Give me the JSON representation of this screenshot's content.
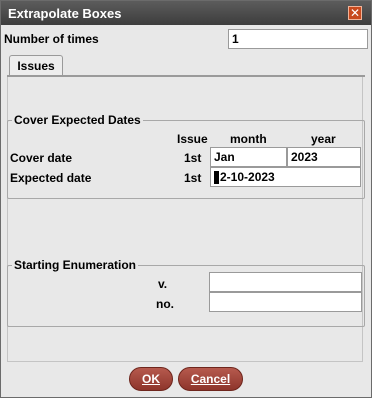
{
  "window": {
    "title": "Extrapolate Boxes",
    "close_icon": "close-icon"
  },
  "number_of_times": {
    "label": "Number of times",
    "value": "1"
  },
  "tabs": [
    {
      "label": "Issues"
    }
  ],
  "cover_expected": {
    "legend": "Cover  Expected Dates",
    "headers": {
      "issue": "Issue",
      "month": "month",
      "year": "year"
    },
    "cover": {
      "label": "Cover date",
      "issue": "1st",
      "month": "Jan",
      "year": "2023"
    },
    "expected": {
      "label": "Expected date",
      "issue": "1st",
      "date": "2-10-2023"
    }
  },
  "enumeration": {
    "legend": "Starting Enumeration",
    "v_label": "v.",
    "v_value": "",
    "no_label": "no.",
    "no_value": ""
  },
  "buttons": {
    "ok": "OK",
    "cancel": "Cancel"
  }
}
